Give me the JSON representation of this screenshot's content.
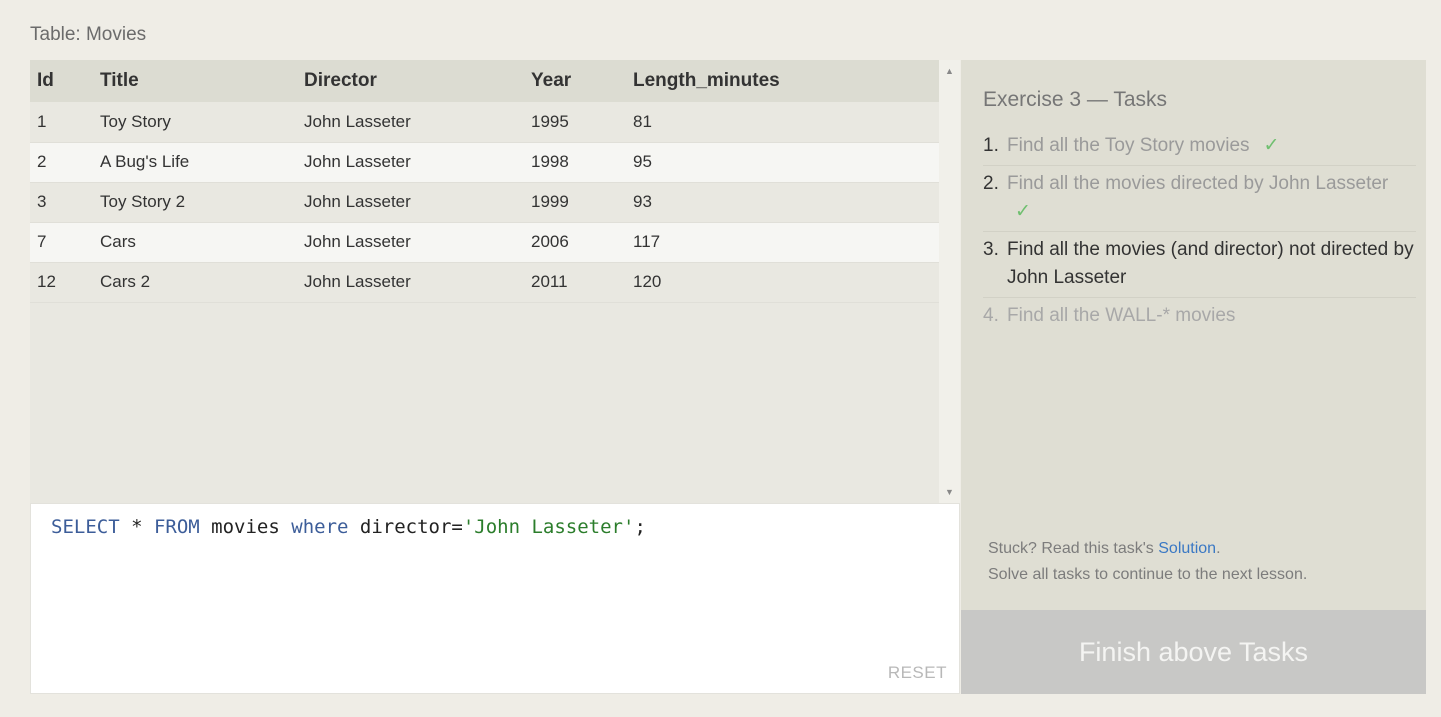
{
  "table_caption": "Table: Movies",
  "columns": [
    "Id",
    "Title",
    "Director",
    "Year",
    "Length_minutes"
  ],
  "rows": [
    [
      "1",
      "Toy Story",
      "John Lasseter",
      "1995",
      "81"
    ],
    [
      "2",
      "A Bug's Life",
      "John Lasseter",
      "1998",
      "95"
    ],
    [
      "3",
      "Toy Story 2",
      "John Lasseter",
      "1999",
      "93"
    ],
    [
      "7",
      "Cars",
      "John Lasseter",
      "2006",
      "117"
    ],
    [
      "12",
      "Cars 2",
      "John Lasseter",
      "2011",
      "120"
    ]
  ],
  "query": {
    "select_kw": "SELECT",
    "star": " * ",
    "from_kw": "FROM",
    "table": " movies ",
    "where_kw": "where",
    "condition": " director=",
    "string_literal": "'John Lasseter'",
    "terminator": ";"
  },
  "reset_label": "RESET",
  "tasks": {
    "heading": "Exercise 3 — Tasks",
    "items": [
      {
        "num": "1.",
        "text": "Find all the Toy Story movies",
        "status": "done",
        "check": "✓"
      },
      {
        "num": "2.",
        "text": "Find all the movies directed by John Lasseter",
        "status": "done",
        "check": "✓"
      },
      {
        "num": "3.",
        "text": "Find all the movies (and director) not directed by John Lasseter",
        "status": "current",
        "check": ""
      },
      {
        "num": "4.",
        "text": "Find all the WALL-* movies",
        "status": "pending",
        "check": ""
      }
    ],
    "stuck_prefix": "Stuck? Read this task's ",
    "solution_link": "Solution",
    "stuck_suffix": ".",
    "continue_note": "Solve all tasks to continue to the next lesson."
  },
  "finish_button": "Finish above Tasks",
  "colors": {
    "check": "#6fbf6f",
    "link": "#3a78c4",
    "keyword": "#3c5d99",
    "string": "#2b7d2b"
  }
}
